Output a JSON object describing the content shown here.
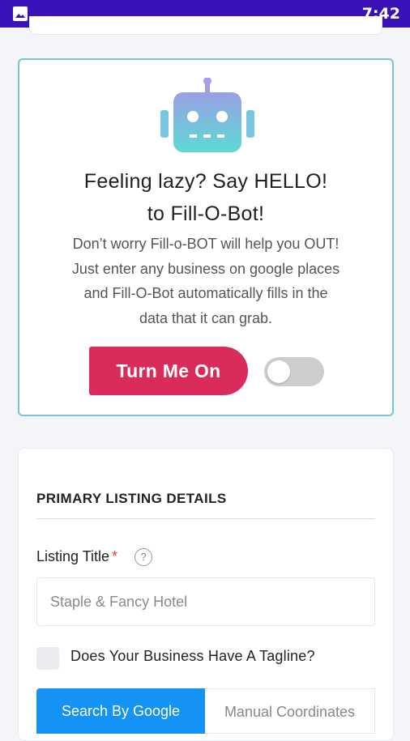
{
  "status_bar": {
    "time": "7:42",
    "notification_icon": "image-icon"
  },
  "bot_card": {
    "title_line1": "Feeling lazy? Say HELLO!",
    "title_line2": "to Fill-O-Bot!",
    "desc_lines": [
      "Don’t worry Fill-o-BOT will help you OUT!",
      "Just enter any business on google places",
      "and Fill-O-Bot automatically fills in the",
      "data that it can grab."
    ],
    "button_label": "Turn Me On",
    "toggle_on": false,
    "robot_icon": "robot-icon",
    "colors": {
      "accent": "#d92c5a",
      "border": "#7cc1d6"
    }
  },
  "listing": {
    "section_title": "PRIMARY LISTING DETAILS",
    "title_label": "Listing Title",
    "required_mark": "*",
    "help_icon": "?",
    "title_placeholder": "Staple & Fancy Hotel",
    "tagline_label": "Does Your Business Have A Tagline?",
    "tabs": [
      {
        "label": "Search By Google",
        "active": true
      },
      {
        "label": "Manual Coordinates",
        "active": false
      }
    ],
    "colors": {
      "tab_active": "#1493f4"
    }
  }
}
